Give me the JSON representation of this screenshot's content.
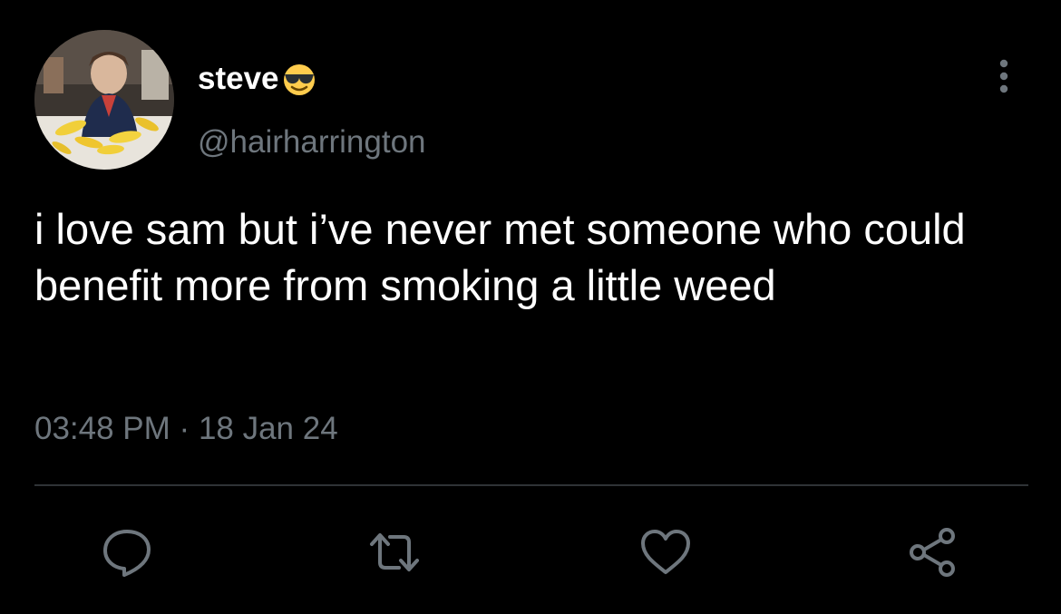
{
  "tweet": {
    "display_name": "steve",
    "emoji_icon": "smiling-face-with-sunglasses-icon",
    "handle": "@hairharrington",
    "text": "i love sam but i’ve never met someone who could benefit more from smoking a little weed",
    "time": "03:48 PM",
    "separator": "·",
    "date": "18 Jan 24"
  },
  "actions": {
    "reply_icon": "reply-icon",
    "retweet_icon": "retweet-icon",
    "like_icon": "heart-icon",
    "share_icon": "share-icon",
    "more_icon": "more-options-icon"
  },
  "colors": {
    "background": "#000000",
    "primary_text": "#ffffff",
    "secondary_text": "#6e767d",
    "divider": "#2f3336",
    "icon": "#6e767d"
  }
}
